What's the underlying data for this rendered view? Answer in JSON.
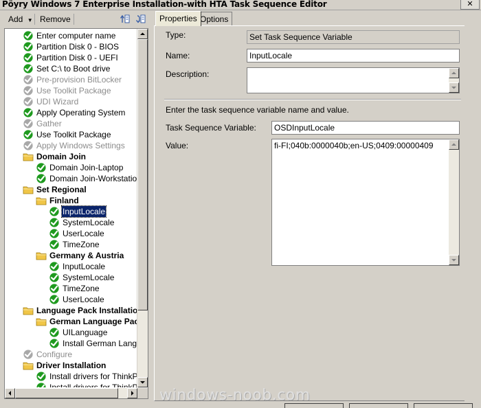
{
  "window": {
    "title": "Pöyry Windows 7 Enterprise Installation-with HTA Task Sequence Editor",
    "close_glyph": "✕"
  },
  "toolbar": {
    "add_label": "Add",
    "remove_label": "Remove"
  },
  "tree": [
    {
      "label": "Enter computer name",
      "icon": "check-icon",
      "depth": 0,
      "state": "enabled"
    },
    {
      "label": "Partition Disk 0 - BIOS",
      "icon": "check-icon",
      "depth": 0,
      "state": "enabled"
    },
    {
      "label": "Partition Disk 0 - UEFI",
      "icon": "check-icon",
      "depth": 0,
      "state": "enabled"
    },
    {
      "label": "Set C:\\ to Boot drive",
      "icon": "check-icon",
      "depth": 0,
      "state": "enabled"
    },
    {
      "label": "Pre-provision BitLocker",
      "icon": "check-disabled-icon",
      "depth": 0,
      "state": "disabled"
    },
    {
      "label": "Use Toolkit Package",
      "icon": "check-disabled-icon",
      "depth": 0,
      "state": "disabled"
    },
    {
      "label": "UDI Wizard",
      "icon": "check-disabled-icon",
      "depth": 0,
      "state": "disabled"
    },
    {
      "label": "Apply Operating System",
      "icon": "check-icon",
      "depth": 0,
      "state": "enabled"
    },
    {
      "label": "Gather",
      "icon": "check-disabled-icon",
      "depth": 0,
      "state": "disabled"
    },
    {
      "label": "Use Toolkit Package",
      "icon": "check-icon",
      "depth": 0,
      "state": "enabled"
    },
    {
      "label": "Apply Windows Settings",
      "icon": "check-disabled-icon",
      "depth": 0,
      "state": "disabled"
    },
    {
      "label": "Domain Join",
      "icon": "folder-icon",
      "depth": 0,
      "state": "group"
    },
    {
      "label": "Domain Join-Laptop",
      "icon": "check-icon",
      "depth": 1,
      "state": "enabled"
    },
    {
      "label": "Domain Join-Workstation",
      "icon": "check-icon",
      "depth": 1,
      "state": "enabled"
    },
    {
      "label": "Set Regional",
      "icon": "folder-icon",
      "depth": 0,
      "state": "group"
    },
    {
      "label": "Finland",
      "icon": "folder-icon",
      "depth": 1,
      "state": "group"
    },
    {
      "label": "InputLocale",
      "icon": "check-icon",
      "depth": 2,
      "state": "selected"
    },
    {
      "label": "SystemLocale",
      "icon": "check-icon",
      "depth": 2,
      "state": "enabled"
    },
    {
      "label": "UserLocale",
      "icon": "check-icon",
      "depth": 2,
      "state": "enabled"
    },
    {
      "label": "TimeZone",
      "icon": "check-icon",
      "depth": 2,
      "state": "enabled"
    },
    {
      "label": "Germany & Austria",
      "icon": "folder-icon",
      "depth": 1,
      "state": "group"
    },
    {
      "label": "InputLocale",
      "icon": "check-icon",
      "depth": 2,
      "state": "enabled"
    },
    {
      "label": "SystemLocale",
      "icon": "check-icon",
      "depth": 2,
      "state": "enabled"
    },
    {
      "label": "TimeZone",
      "icon": "check-icon",
      "depth": 2,
      "state": "enabled"
    },
    {
      "label": "UserLocale",
      "icon": "check-icon",
      "depth": 2,
      "state": "enabled"
    },
    {
      "label": "Language Pack Installation",
      "icon": "folder-icon",
      "depth": 0,
      "state": "group"
    },
    {
      "label": "German Language Pack",
      "icon": "folder-icon",
      "depth": 1,
      "state": "group"
    },
    {
      "label": "UILanguage",
      "icon": "check-icon",
      "depth": 2,
      "state": "enabled"
    },
    {
      "label": "Install German Language",
      "icon": "check-icon",
      "depth": 2,
      "state": "enabled"
    },
    {
      "label": "Configure",
      "icon": "check-disabled-icon",
      "depth": 0,
      "state": "disabled"
    },
    {
      "label": "Driver Installation",
      "icon": "folder-icon",
      "depth": 0,
      "state": "group"
    },
    {
      "label": "Install drivers for ThinkPad",
      "icon": "check-icon",
      "depth": 1,
      "state": "enabled"
    },
    {
      "label": "Install drivers for ThinkPad",
      "icon": "check-icon",
      "depth": 1,
      "state": "enabled"
    }
  ],
  "tabs": [
    {
      "label": "Properties",
      "active": true
    },
    {
      "label": "Options",
      "active": false
    }
  ],
  "properties": {
    "type_label": "Type:",
    "type_value": "Set Task Sequence Variable",
    "name_label": "Name:",
    "name_value": "InputLocale",
    "description_label": "Description:",
    "description_value": "",
    "instructions": "Enter the task sequence variable name and value.",
    "variable_label": "Task Sequence Variable:",
    "variable_value": "OSDInputLocale",
    "value_label": "Value:",
    "value_value": "fi-FI;040b:0000040b;en-US;0409:00000409"
  },
  "watermark": "windows-noob.com",
  "colors": {
    "selection": "#0a246a",
    "check_green": "#1f9a1f",
    "folder_yellow": "#f0c648",
    "disabled_text": "#8c8c8c"
  }
}
